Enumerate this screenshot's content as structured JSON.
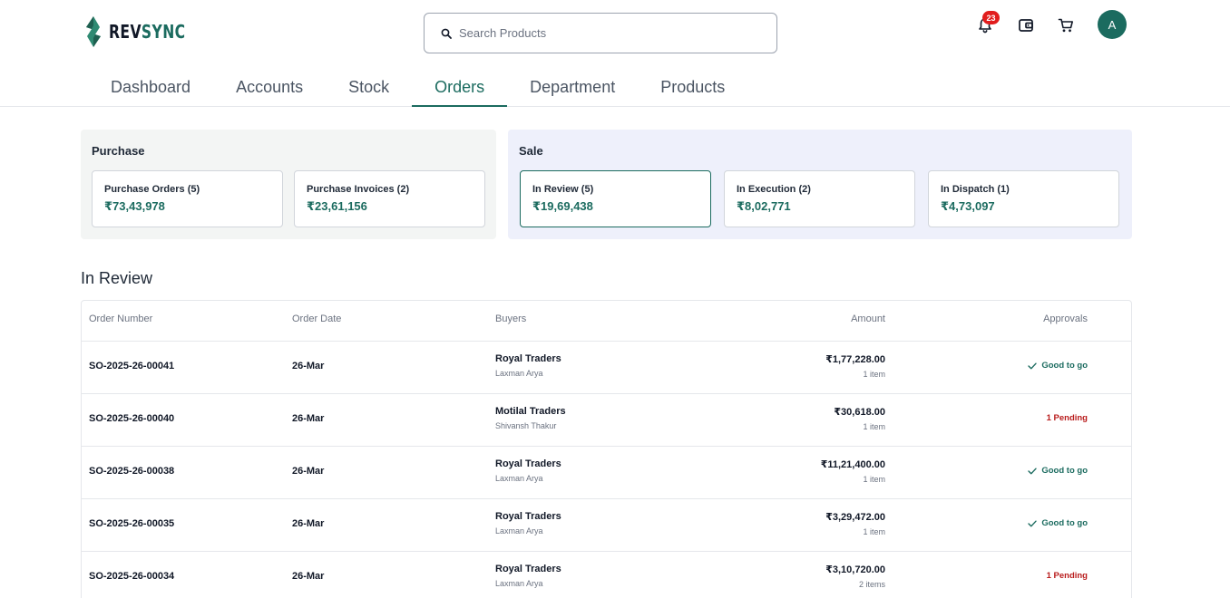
{
  "brand": {
    "name_part1": "REV",
    "name_part2": "SYNC",
    "accent": "#1b6b5f"
  },
  "search": {
    "placeholder": "Search Products",
    "icon": "search-icon"
  },
  "header": {
    "notification_count": "23",
    "avatar_initial": "A",
    "icons": [
      "bell-icon",
      "wallet-icon",
      "cart-icon"
    ]
  },
  "tabs": [
    {
      "label": "Dashboard"
    },
    {
      "label": "Accounts"
    },
    {
      "label": "Stock"
    },
    {
      "label": "Orders",
      "active": true
    },
    {
      "label": "Department"
    },
    {
      "label": "Products"
    }
  ],
  "purchase": {
    "title": "Purchase",
    "cards": [
      {
        "label": "Purchase Orders (5)",
        "value": "₹73,43,978"
      },
      {
        "label": "Purchase Invoices (2)",
        "value": "₹23,61,156"
      }
    ]
  },
  "sale": {
    "title": "Sale",
    "cards": [
      {
        "label": "In Review (5)",
        "value": "₹19,69,438",
        "selected": true
      },
      {
        "label": "In Execution (2)",
        "value": "₹8,02,771"
      },
      {
        "label": "In Dispatch (1)",
        "value": "₹4,73,097"
      }
    ]
  },
  "section": {
    "title": "In Review"
  },
  "table": {
    "columns": {
      "order": "Order Number",
      "date": "Order Date",
      "buyers": "Buyers",
      "amount": "Amount",
      "approvals": "Approvals"
    },
    "rows": [
      {
        "order": "SO-2025-26-00041",
        "date": "26-Mar",
        "buyer": "Royal Traders",
        "contact": "Laxman Arya",
        "amount": "₹1,77,228.00",
        "items": "1 item",
        "approval": "Good to go",
        "status": "ok"
      },
      {
        "order": "SO-2025-26-00040",
        "date": "26-Mar",
        "buyer": "Motilal Traders",
        "contact": "Shivansh Thakur",
        "amount": "₹30,618.00",
        "items": "1 item",
        "approval": "1 Pending",
        "status": "pending"
      },
      {
        "order": "SO-2025-26-00038",
        "date": "26-Mar",
        "buyer": "Royal Traders",
        "contact": "Laxman Arya",
        "amount": "₹11,21,400.00",
        "items": "1 item",
        "approval": "Good to go",
        "status": "ok"
      },
      {
        "order": "SO-2025-26-00035",
        "date": "26-Mar",
        "buyer": "Royal Traders",
        "contact": "Laxman Arya",
        "amount": "₹3,29,472.00",
        "items": "1 item",
        "approval": "Good to go",
        "status": "ok"
      },
      {
        "order": "SO-2025-26-00034",
        "date": "26-Mar",
        "buyer": "Royal Traders",
        "contact": "Laxman Arya",
        "amount": "₹3,10,720.00",
        "items": "2 items",
        "approval": "1 Pending",
        "status": "pending"
      }
    ]
  }
}
